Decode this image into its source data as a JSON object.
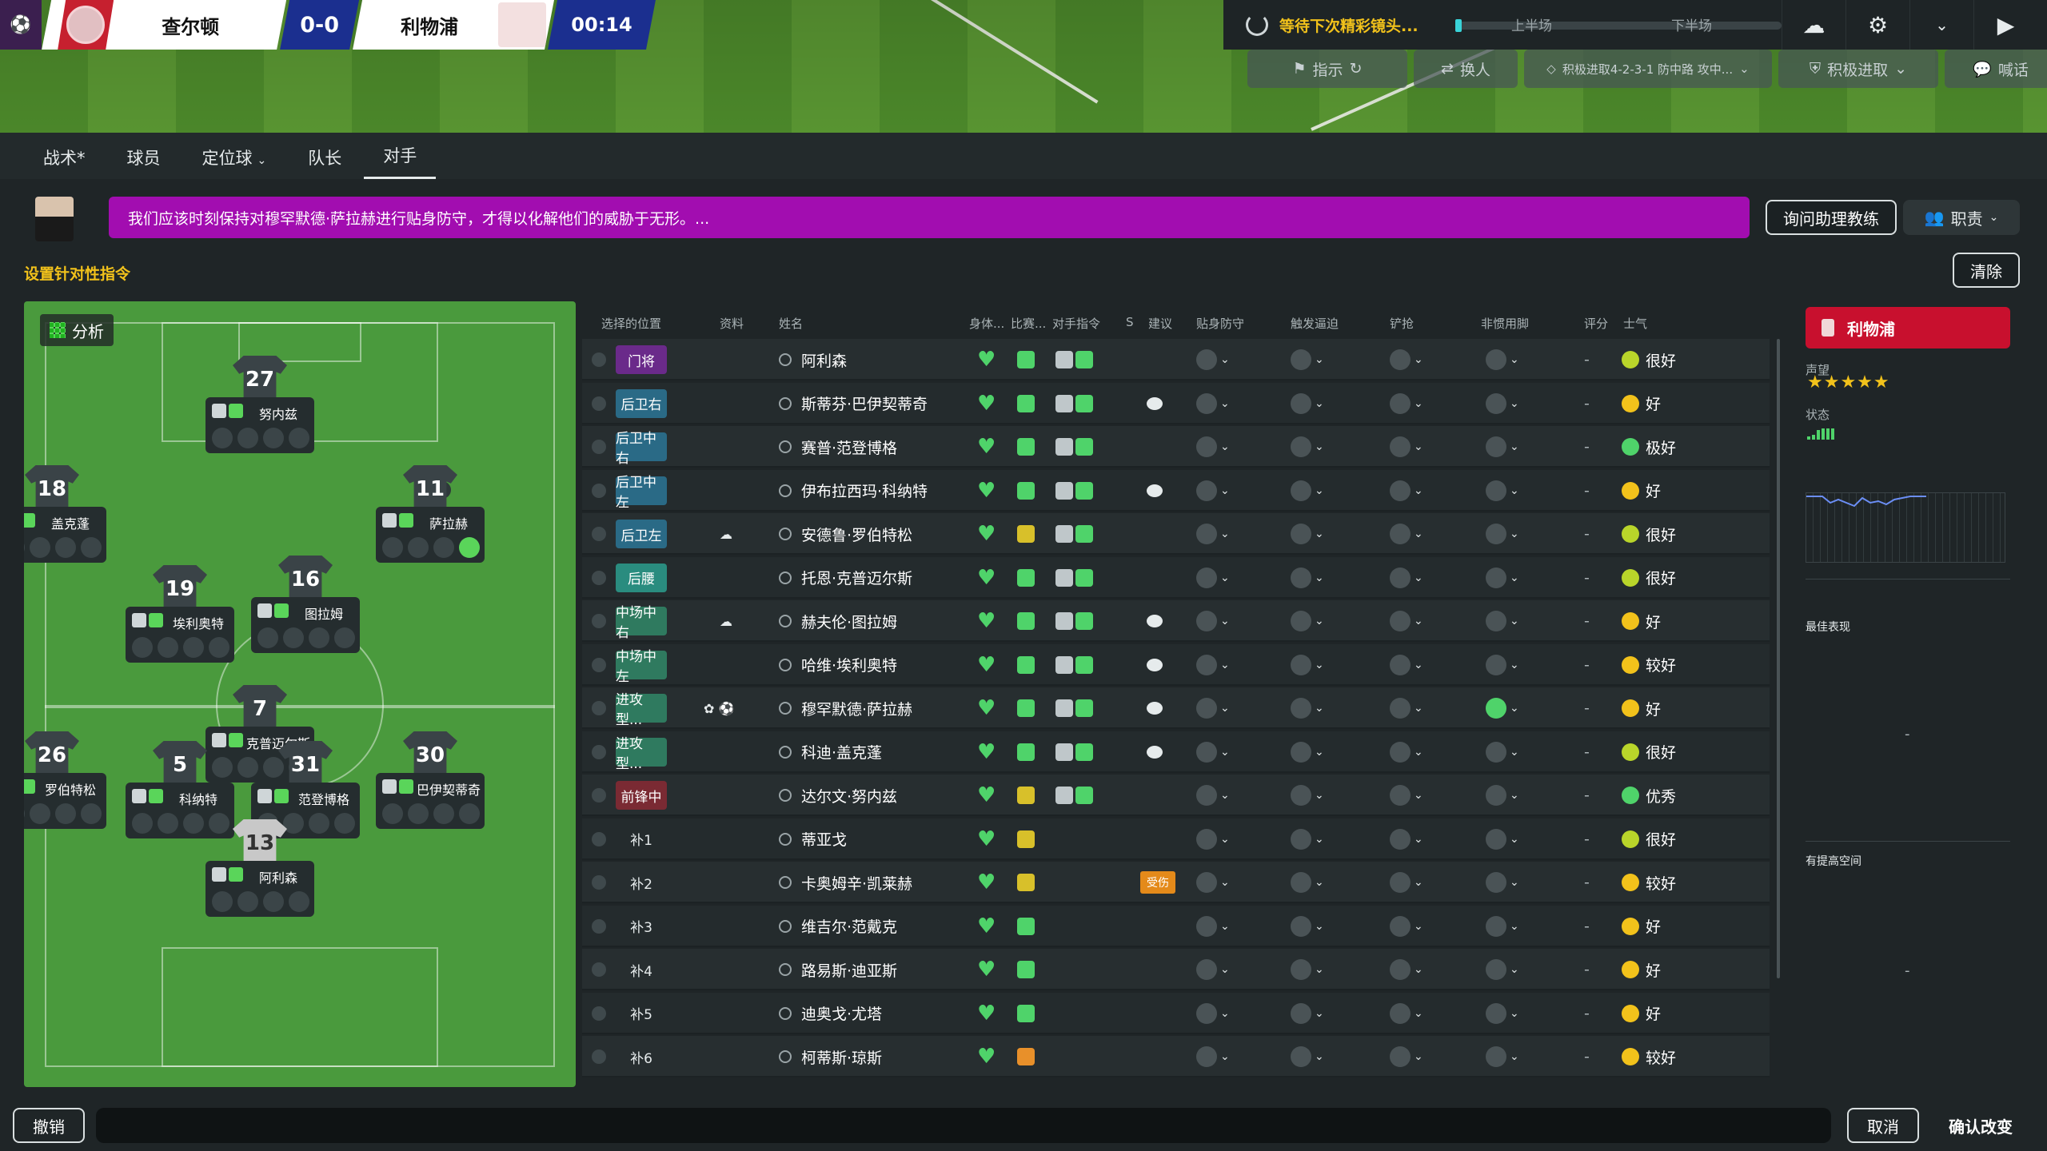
{
  "scoreboard": {
    "home_team": "查尔顿",
    "score": "0-0",
    "away_team": "利物浦",
    "clock": "00:14"
  },
  "topbar": {
    "waiting_text": "等待下次精彩镜头...",
    "first_half": "上半场",
    "second_half": "下半场",
    "match_progress_fraction": 0.02
  },
  "actions": [
    {
      "label": "指示",
      "icon": "whistle-icon"
    },
    {
      "label": "换人",
      "icon": "swap-icon"
    },
    {
      "label": "积极进取4-2-3-1 防中路 攻中...",
      "icon": "formation-icon"
    },
    {
      "label": "积极进取",
      "icon": "shield-icon"
    },
    {
      "label": "喊话",
      "icon": "speech-icon"
    }
  ],
  "tabs": [
    {
      "label": "战术*"
    },
    {
      "label": "球员"
    },
    {
      "label": "定位球"
    },
    {
      "label": "队长"
    },
    {
      "label": "对手"
    }
  ],
  "advice": {
    "text": "我们应该时刻保持对穆罕默德·萨拉赫进行贴身防守，才得以化解他们的威胁于无形。..."
  },
  "buttons": {
    "ask_assistant": "询问助理教练",
    "duty": "职责",
    "clear": "清除",
    "undo": "撤销",
    "cancel": "取消",
    "confirm": "确认改变"
  },
  "section_title": "设置针对性指令",
  "pitch": {
    "analysis_label": "分析",
    "captain_mark": "C",
    "players": [
      {
        "number": "27",
        "name": "努内兹"
      },
      {
        "number": "18",
        "name": "盖克蓬"
      },
      {
        "number": "11",
        "name": "萨拉赫"
      },
      {
        "number": "19",
        "name": "埃利奥特"
      },
      {
        "number": "16",
        "name": "图拉姆"
      },
      {
        "number": "7",
        "name": "克普迈尔斯"
      },
      {
        "number": "26",
        "name": "罗伯特松"
      },
      {
        "number": "5",
        "name": "科纳特"
      },
      {
        "number": "31",
        "name": "范登博格"
      },
      {
        "number": "30",
        "name": "巴伊契蒂奇"
      },
      {
        "number": "13",
        "name": "阿利森"
      }
    ]
  },
  "table": {
    "headers": [
      "选择的位置",
      "资料",
      "姓名",
      "身体...",
      "比赛...",
      "对手指令",
      "S",
      "建议",
      "贴身防守",
      "触发逼迫",
      "铲抢",
      "非惯用脚",
      "评分",
      "士气"
    ],
    "rows": [
      {
        "pos": "门将",
        "name": "阿利森",
        "rating": "-",
        "morale": "很好",
        "advice": ""
      },
      {
        "pos": "后卫右",
        "name": "斯蒂芬·巴伊契蒂奇",
        "rating": "-",
        "morale": "好",
        "advice": "bubble"
      },
      {
        "pos": "后卫中右",
        "name": "赛普·范登博格",
        "rating": "-",
        "morale": "极好",
        "advice": ""
      },
      {
        "pos": "后卫中左",
        "name": "伊布拉西玛·科纳特",
        "rating": "-",
        "morale": "好",
        "advice": "bubble"
      },
      {
        "pos": "后卫左",
        "name": "安德鲁·罗伯特松",
        "rating": "-",
        "morale": "很好",
        "advice": ""
      },
      {
        "pos": "后腰",
        "name": "托恩·克普迈尔斯",
        "rating": "-",
        "morale": "很好",
        "advice": ""
      },
      {
        "pos": "中场中右",
        "name": "赫夫伦·图拉姆",
        "rating": "-",
        "morale": "好",
        "advice": "bubble"
      },
      {
        "pos": "中场中左",
        "name": "哈维·埃利奥特",
        "rating": "-",
        "morale": "较好",
        "advice": "bubble"
      },
      {
        "pos": "进攻型...",
        "name": "穆罕默德·萨拉赫",
        "rating": "-",
        "morale": "好",
        "advice": "bubble"
      },
      {
        "pos": "进攻型...",
        "name": "科迪·盖克蓬",
        "rating": "-",
        "morale": "很好",
        "advice": "bubble"
      },
      {
        "pos": "前锋中",
        "name": "达尔文·努内兹",
        "rating": "-",
        "morale": "优秀",
        "advice": ""
      },
      {
        "pos": "补1",
        "name": "蒂亚戈",
        "rating": "-",
        "morale": "很好",
        "advice": ""
      },
      {
        "pos": "补2",
        "name": "卡奥姆辛·凯莱赫",
        "rating": "-",
        "morale": "较好",
        "advice": "受伤"
      },
      {
        "pos": "补3",
        "name": "维吉尔·范戴克",
        "rating": "-",
        "morale": "好",
        "advice": ""
      },
      {
        "pos": "补4",
        "name": "路易斯·迪亚斯",
        "rating": "-",
        "morale": "好",
        "advice": ""
      },
      {
        "pos": "补5",
        "name": "迪奥戈·尤塔",
        "rating": "-",
        "morale": "好",
        "advice": ""
      },
      {
        "pos": "补6",
        "name": "柯蒂斯·琼斯",
        "rating": "-",
        "morale": "较好",
        "advice": ""
      }
    ]
  },
  "opponent_panel": {
    "club": "利物浦",
    "reputation_label": "声望",
    "reputation_stars": "★★★★★",
    "status_label": "状态",
    "best_label": "最佳表现",
    "best_value": "-",
    "improve_label": "有提高空间",
    "improve_value": "-"
  },
  "colors": {
    "advice_banner": "#a20db0",
    "accent_yellow": "#f2c21b",
    "club_red": "#c8102e",
    "good_green": "#4fd36a"
  }
}
